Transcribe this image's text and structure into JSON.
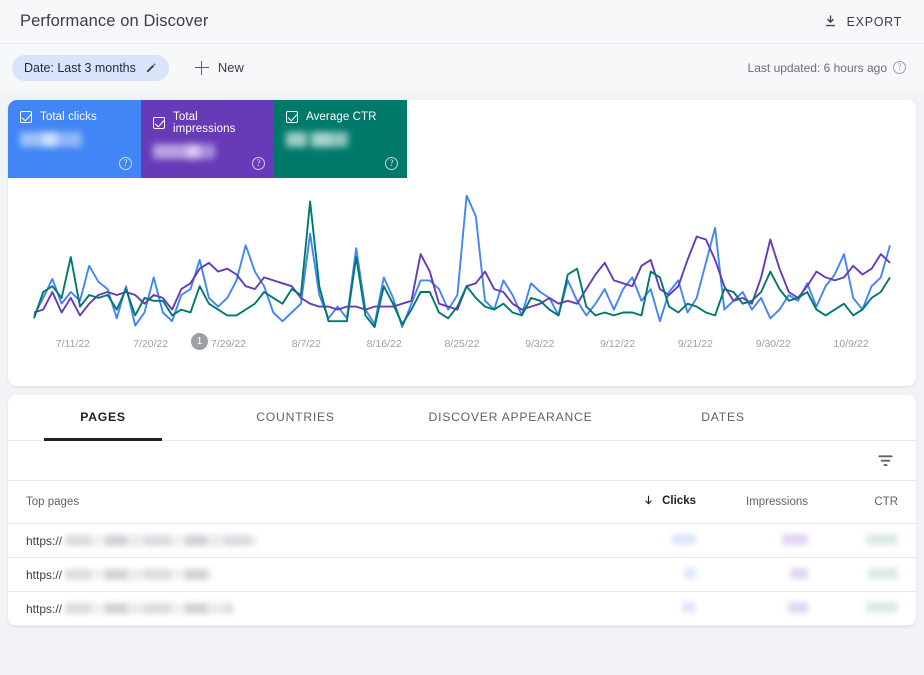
{
  "header": {
    "title": "Performance on Discover",
    "export_label": "EXPORT",
    "export_icon": "download-icon"
  },
  "filterbar": {
    "date_chip_label": "Date: Last 3 months",
    "edit_icon": "pencil-icon",
    "new_label": "New",
    "add_icon": "plus-icon",
    "last_updated": "Last updated: 6 hours ago",
    "help_icon": "help-icon",
    "help_glyph": "?"
  },
  "metrics": [
    {
      "label": "Total clicks",
      "color": "#4285f4",
      "checked": true,
      "value": "",
      "help_glyph": "?"
    },
    {
      "label": "Total impressions",
      "color": "#673ab7",
      "checked": true,
      "value": "",
      "help_glyph": "?"
    },
    {
      "label": "Average CTR",
      "color": "#00796b",
      "checked": true,
      "value": "",
      "help_glyph": "?"
    }
  ],
  "chart_data": {
    "type": "line",
    "title": "Performance on Discover",
    "xlabel": "",
    "ylabel": "",
    "grid": false,
    "legend_position": "top-cards",
    "annotations": [
      {
        "label": "1",
        "x_index": 18
      }
    ],
    "tick_labels": [
      "7/11/22",
      "7/20/22",
      "7/29/22",
      "8/7/22",
      "8/16/22",
      "8/25/22",
      "9/3/22",
      "9/12/22",
      "9/21/22",
      "9/30/22",
      "10/9/22"
    ],
    "x_range": [
      "7/11/22",
      "10/13/22"
    ],
    "ylim": [
      0,
      100
    ],
    "series": [
      {
        "name": "Total clicks",
        "color": "#4285f4",
        "values": [
          10,
          22,
          35,
          18,
          26,
          20,
          44,
          33,
          28,
          8,
          30,
          3,
          12,
          36,
          12,
          6,
          24,
          28,
          48,
          22,
          16,
          22,
          34,
          58,
          40,
          30,
          12,
          6,
          12,
          18,
          66,
          24,
          8,
          16,
          8,
          56,
          14,
          4,
          36,
          22,
          2,
          18,
          34,
          34,
          28,
          14,
          24,
          92,
          78,
          20,
          14,
          34,
          24,
          10,
          32,
          26,
          22,
          10,
          34,
          20,
          10,
          18,
          28,
          14,
          28,
          36,
          20,
          28,
          6,
          26,
          34,
          12,
          22,
          46,
          70,
          14,
          20,
          26,
          14,
          22,
          8,
          14,
          24,
          20,
          32,
          16,
          30,
          38,
          52,
          22,
          14,
          30,
          36,
          58
        ]
      },
      {
        "name": "Total impressions",
        "color": "#673ab7",
        "values": [
          12,
          14,
          26,
          12,
          22,
          10,
          18,
          24,
          26,
          24,
          26,
          24,
          18,
          24,
          22,
          14,
          28,
          32,
          42,
          46,
          40,
          42,
          38,
          30,
          28,
          36,
          34,
          32,
          30,
          22,
          18,
          16,
          16,
          14,
          16,
          16,
          14,
          16,
          16,
          16,
          18,
          20,
          52,
          40,
          18,
          16,
          14,
          30,
          32,
          40,
          28,
          26,
          18,
          14,
          16,
          18,
          22,
          18,
          20,
          18,
          28,
          38,
          46,
          34,
          32,
          30,
          44,
          48,
          28,
          24,
          30,
          48,
          64,
          62,
          48,
          30,
          20,
          22,
          18,
          36,
          62,
          42,
          26,
          22,
          30,
          40,
          36,
          34,
          36,
          44,
          38,
          42,
          52,
          46
        ]
      },
      {
        "name": "Average CTR",
        "color": "#00796b",
        "values": [
          8,
          26,
          30,
          22,
          50,
          16,
          24,
          22,
          24,
          14,
          28,
          10,
          22,
          20,
          20,
          10,
          14,
          12,
          30,
          18,
          14,
          10,
          10,
          14,
          18,
          26,
          22,
          18,
          28,
          24,
          88,
          30,
          6,
          6,
          6,
          50,
          10,
          2,
          30,
          18,
          4,
          14,
          26,
          26,
          12,
          8,
          16,
          30,
          22,
          16,
          14,
          18,
          12,
          10,
          22,
          20,
          14,
          10,
          38,
          42,
          16,
          10,
          12,
          10,
          12,
          12,
          10,
          40,
          36,
          16,
          12,
          18,
          16,
          12,
          10,
          28,
          26,
          18,
          20,
          26,
          40,
          28,
          20,
          22,
          26,
          14,
          10,
          14,
          18,
          10,
          14,
          22,
          26,
          36
        ]
      }
    ]
  },
  "table": {
    "tabs": [
      {
        "label": "PAGES",
        "active": true
      },
      {
        "label": "COUNTRIES",
        "active": false
      },
      {
        "label": "DISCOVER APPEARANCE",
        "active": false
      },
      {
        "label": "DATES",
        "active": false
      }
    ],
    "filter_icon": "filter-icon",
    "columns": {
      "page": "Top pages",
      "clicks": "Clicks",
      "impressions": "Impressions",
      "ctr": "CTR"
    },
    "sort": {
      "column": "Clicks",
      "direction": "descending",
      "icon": "arrow-down-icon"
    },
    "rows": [
      {
        "url_prefix": "https://",
        "url_redacted": true,
        "url_width": 192,
        "clicks": "",
        "clicks_width": 24,
        "impressions": "",
        "impressions_width": 26,
        "ctr": "",
        "ctr_width": 32
      },
      {
        "url_prefix": "https://",
        "url_redacted": true,
        "url_width": 146,
        "clicks": "",
        "clicks_width": 12,
        "impressions": "",
        "impressions_width": 18,
        "ctr": "",
        "ctr_width": 30
      },
      {
        "url_prefix": "https://",
        "url_redacted": true,
        "url_width": 168,
        "clicks": "",
        "clicks_width": 14,
        "impressions": "",
        "impressions_width": 20,
        "ctr": "",
        "ctr_width": 32
      }
    ]
  }
}
